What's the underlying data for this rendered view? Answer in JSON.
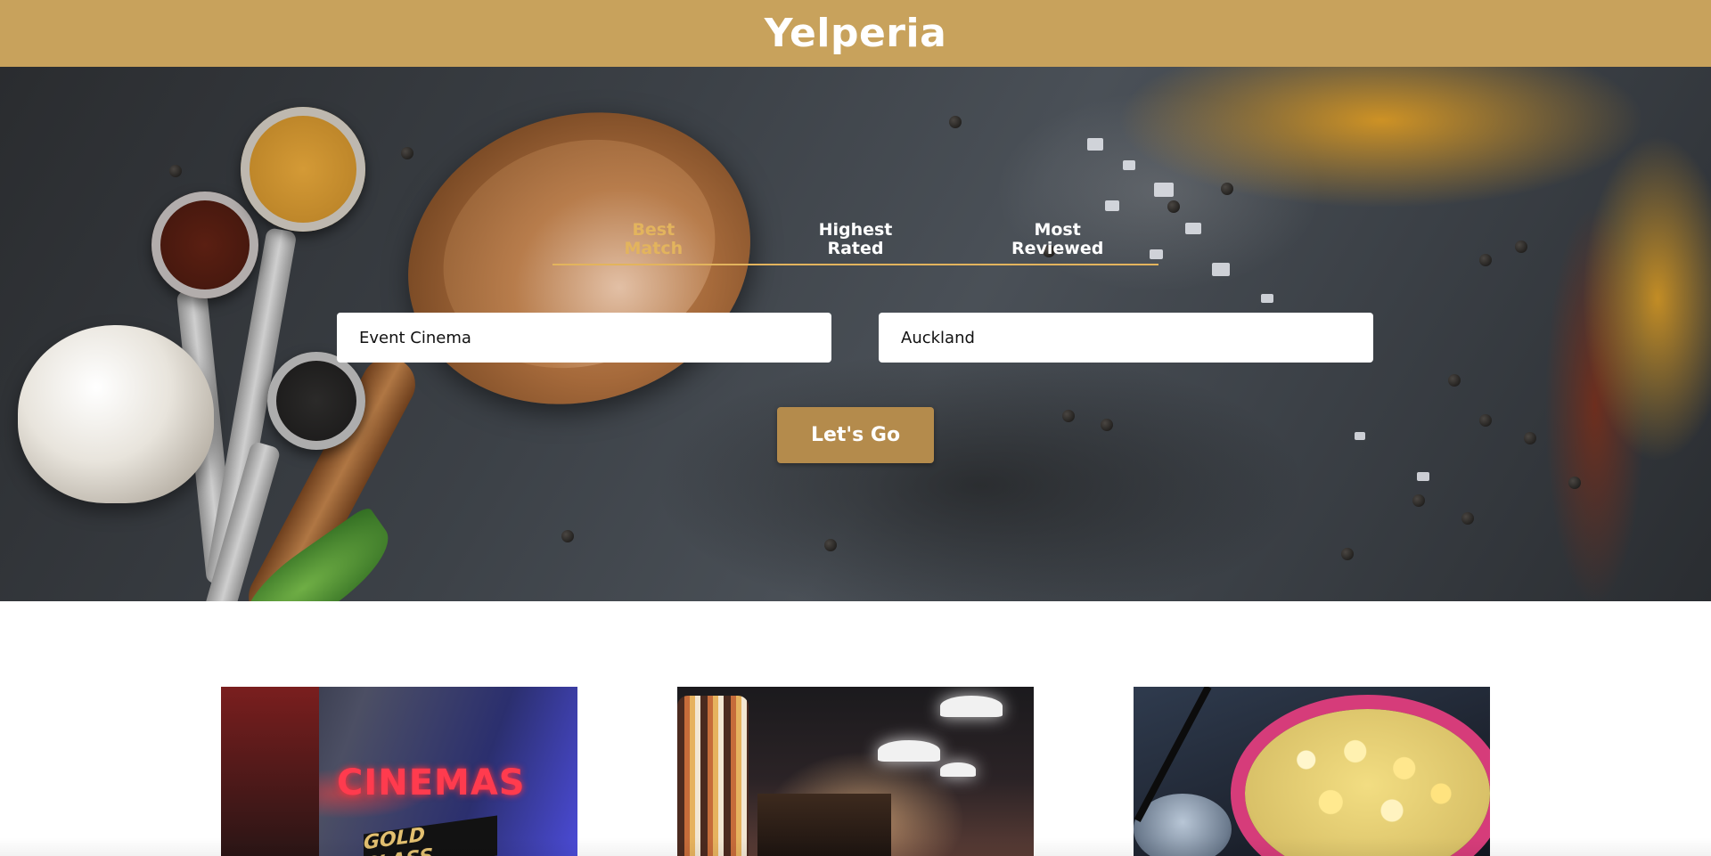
{
  "app": {
    "brand": "Yelperia"
  },
  "header": {
    "background_color": "#c8a25c"
  },
  "sort_tabs": [
    {
      "label": "Best\nMatch",
      "active": true
    },
    {
      "label": "Highest\nRated",
      "active": false
    },
    {
      "label": "Most\nReviewed",
      "active": false
    }
  ],
  "search": {
    "term_value": "Event Cinema",
    "location_value": "Auckland",
    "submit_label": "Let's Go"
  },
  "colors": {
    "accent": "#e3b45d",
    "button": "#b48b4c"
  },
  "results": [
    {
      "image_icon": "cinema-storefront-image",
      "sign_text": "CINEMAS",
      "sub_sign_text": "GOLD CLASS"
    },
    {
      "image_icon": "cinema-lobby-image"
    },
    {
      "image_icon": "popcorn-drink-image"
    }
  ]
}
